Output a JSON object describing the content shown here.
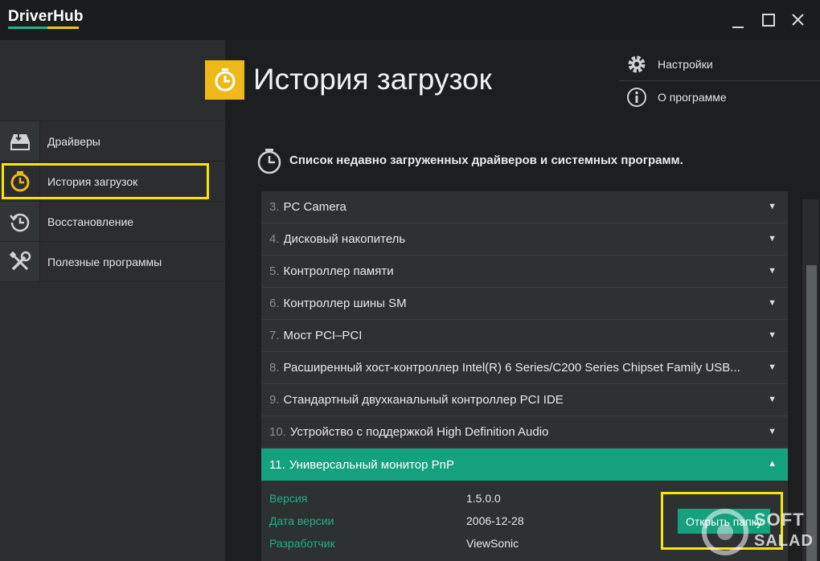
{
  "app": {
    "logo_text": "DriverHub"
  },
  "window_controls": [
    "minimize-icon",
    "maximize-icon",
    "close-icon"
  ],
  "header": {
    "title": "История загрузок",
    "icon": "clock-icon"
  },
  "menu": [
    {
      "label": "Настройки",
      "icon": "gear-icon"
    },
    {
      "label": "О программе",
      "icon": "info-icon"
    }
  ],
  "sidebar": {
    "items": [
      {
        "label": "Драйверы",
        "icon": "drive-icon"
      },
      {
        "label": "История загрузок",
        "icon": "clock-icon",
        "active": true
      },
      {
        "label": "Восстановление",
        "icon": "history-icon"
      },
      {
        "label": "Полезные программы",
        "icon": "tools-icon"
      }
    ]
  },
  "content": {
    "heading": "Список недавно загруженных драйверов и системных программ."
  },
  "list": {
    "items": [
      {
        "num": "3.",
        "name": "PC Camera"
      },
      {
        "num": "4.",
        "name": "Дисковый накопитель"
      },
      {
        "num": "5.",
        "name": "Контроллер памяти"
      },
      {
        "num": "6.",
        "name": "Контроллер шины SM"
      },
      {
        "num": "7.",
        "name": "Мост PCI–PCI"
      },
      {
        "num": "8.",
        "name": "Расширенный хост-контроллер Intel(R) 6 Series/C200 Series Chipset Family USB..."
      },
      {
        "num": "9.",
        "name": "Стандартный двухканальный контроллер PCI IDE"
      },
      {
        "num": "10.",
        "name": "Устройство с поддержкой High Definition Audio"
      },
      {
        "num": "11.",
        "name": "Универсальный монитор PnP",
        "expanded": true
      }
    ]
  },
  "details": {
    "version_label": "Версия",
    "version_value": "1.5.0.0",
    "date_label": "Дата версии",
    "date_value": "2006-12-28",
    "developer_label": "Разработчик",
    "developer_value": "ViewSonic",
    "open_folder_label": "Открыть папку"
  },
  "watermark": {
    "line1": "SOFT",
    "line2": "SALAD"
  },
  "colors": {
    "accent": "#15a07e",
    "header_icon": "#f0b91b",
    "highlight": "#f5e50a"
  }
}
